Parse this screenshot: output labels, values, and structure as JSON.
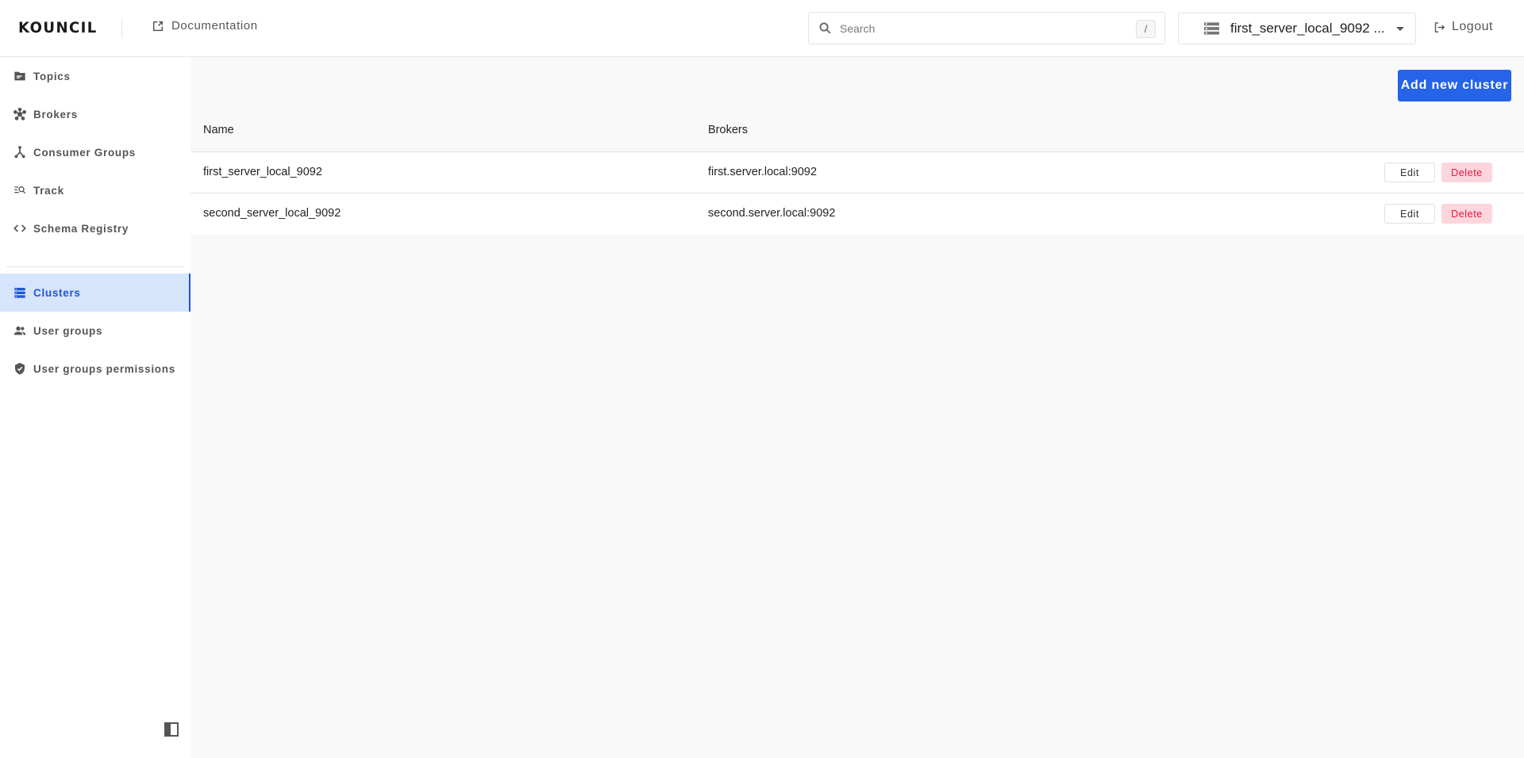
{
  "header": {
    "logo": "KOUNCIL",
    "documentation_link": "Documentation",
    "search": {
      "placeholder": "Search",
      "value": "",
      "shortcut": "/"
    },
    "cluster_select": {
      "selected": "first_server_local_9092 ..."
    },
    "logout": "Logout"
  },
  "sidebar": {
    "items": [
      {
        "label": "Topics",
        "icon": "folder-icon"
      },
      {
        "label": "Brokers",
        "icon": "hub-icon"
      },
      {
        "label": "Consumer Groups",
        "icon": "merge-icon"
      },
      {
        "label": "Track",
        "icon": "track-search-icon"
      },
      {
        "label": "Schema Registry",
        "icon": "code-icon"
      },
      {
        "label": "Clusters",
        "icon": "server-list-icon",
        "active": true
      },
      {
        "label": "User groups",
        "icon": "users-icon"
      },
      {
        "label": "User groups permissions",
        "icon": "shield-check-icon"
      }
    ],
    "collapse_icon": "sidebar-collapse-icon"
  },
  "main": {
    "add_button": "Add new cluster",
    "table": {
      "columns": [
        "Name",
        "Brokers"
      ],
      "rows": [
        {
          "name": "first_server_local_9092",
          "brokers": "first.server.local:9092"
        },
        {
          "name": "second_server_local_9092",
          "brokers": "second.server.local:9092"
        }
      ],
      "row_actions": {
        "edit": "Edit",
        "delete": "Delete"
      }
    }
  },
  "colors": {
    "accent": "#2563e8",
    "active_nav_bg": "#d6e4fc",
    "active_nav_text": "#1f56d6",
    "delete_bg": "#fdd6dd",
    "delete_text": "#e0183e"
  }
}
